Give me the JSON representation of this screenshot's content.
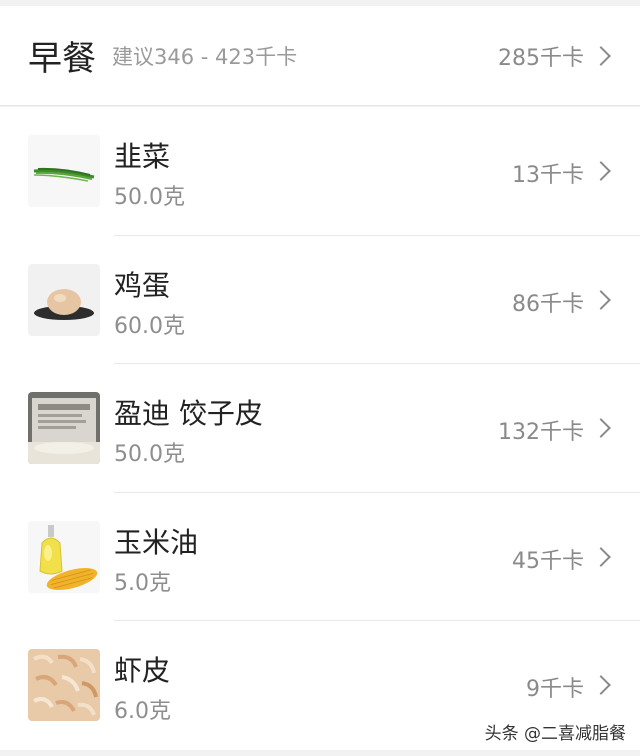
{
  "meal": {
    "title": "早餐",
    "suggestion": "建议346 - 423千卡",
    "total": "285千卡"
  },
  "items": [
    {
      "name": "韭菜",
      "amount": "50.0克",
      "kcal": "13千卡",
      "icon": "chives-image"
    },
    {
      "name": "鸡蛋",
      "amount": "60.0克",
      "kcal": "86千卡",
      "icon": "egg-image"
    },
    {
      "name": "盈迪 饺子皮",
      "amount": "50.0克",
      "kcal": "132千卡",
      "icon": "dumpling-wrapper-image"
    },
    {
      "name": "玉米油",
      "amount": "5.0克",
      "kcal": "45千卡",
      "icon": "corn-oil-image"
    },
    {
      "name": "虾皮",
      "amount": "6.0克",
      "kcal": "9千卡",
      "icon": "dried-shrimp-image"
    }
  ],
  "watermark": "头条 @二喜减脂餐"
}
